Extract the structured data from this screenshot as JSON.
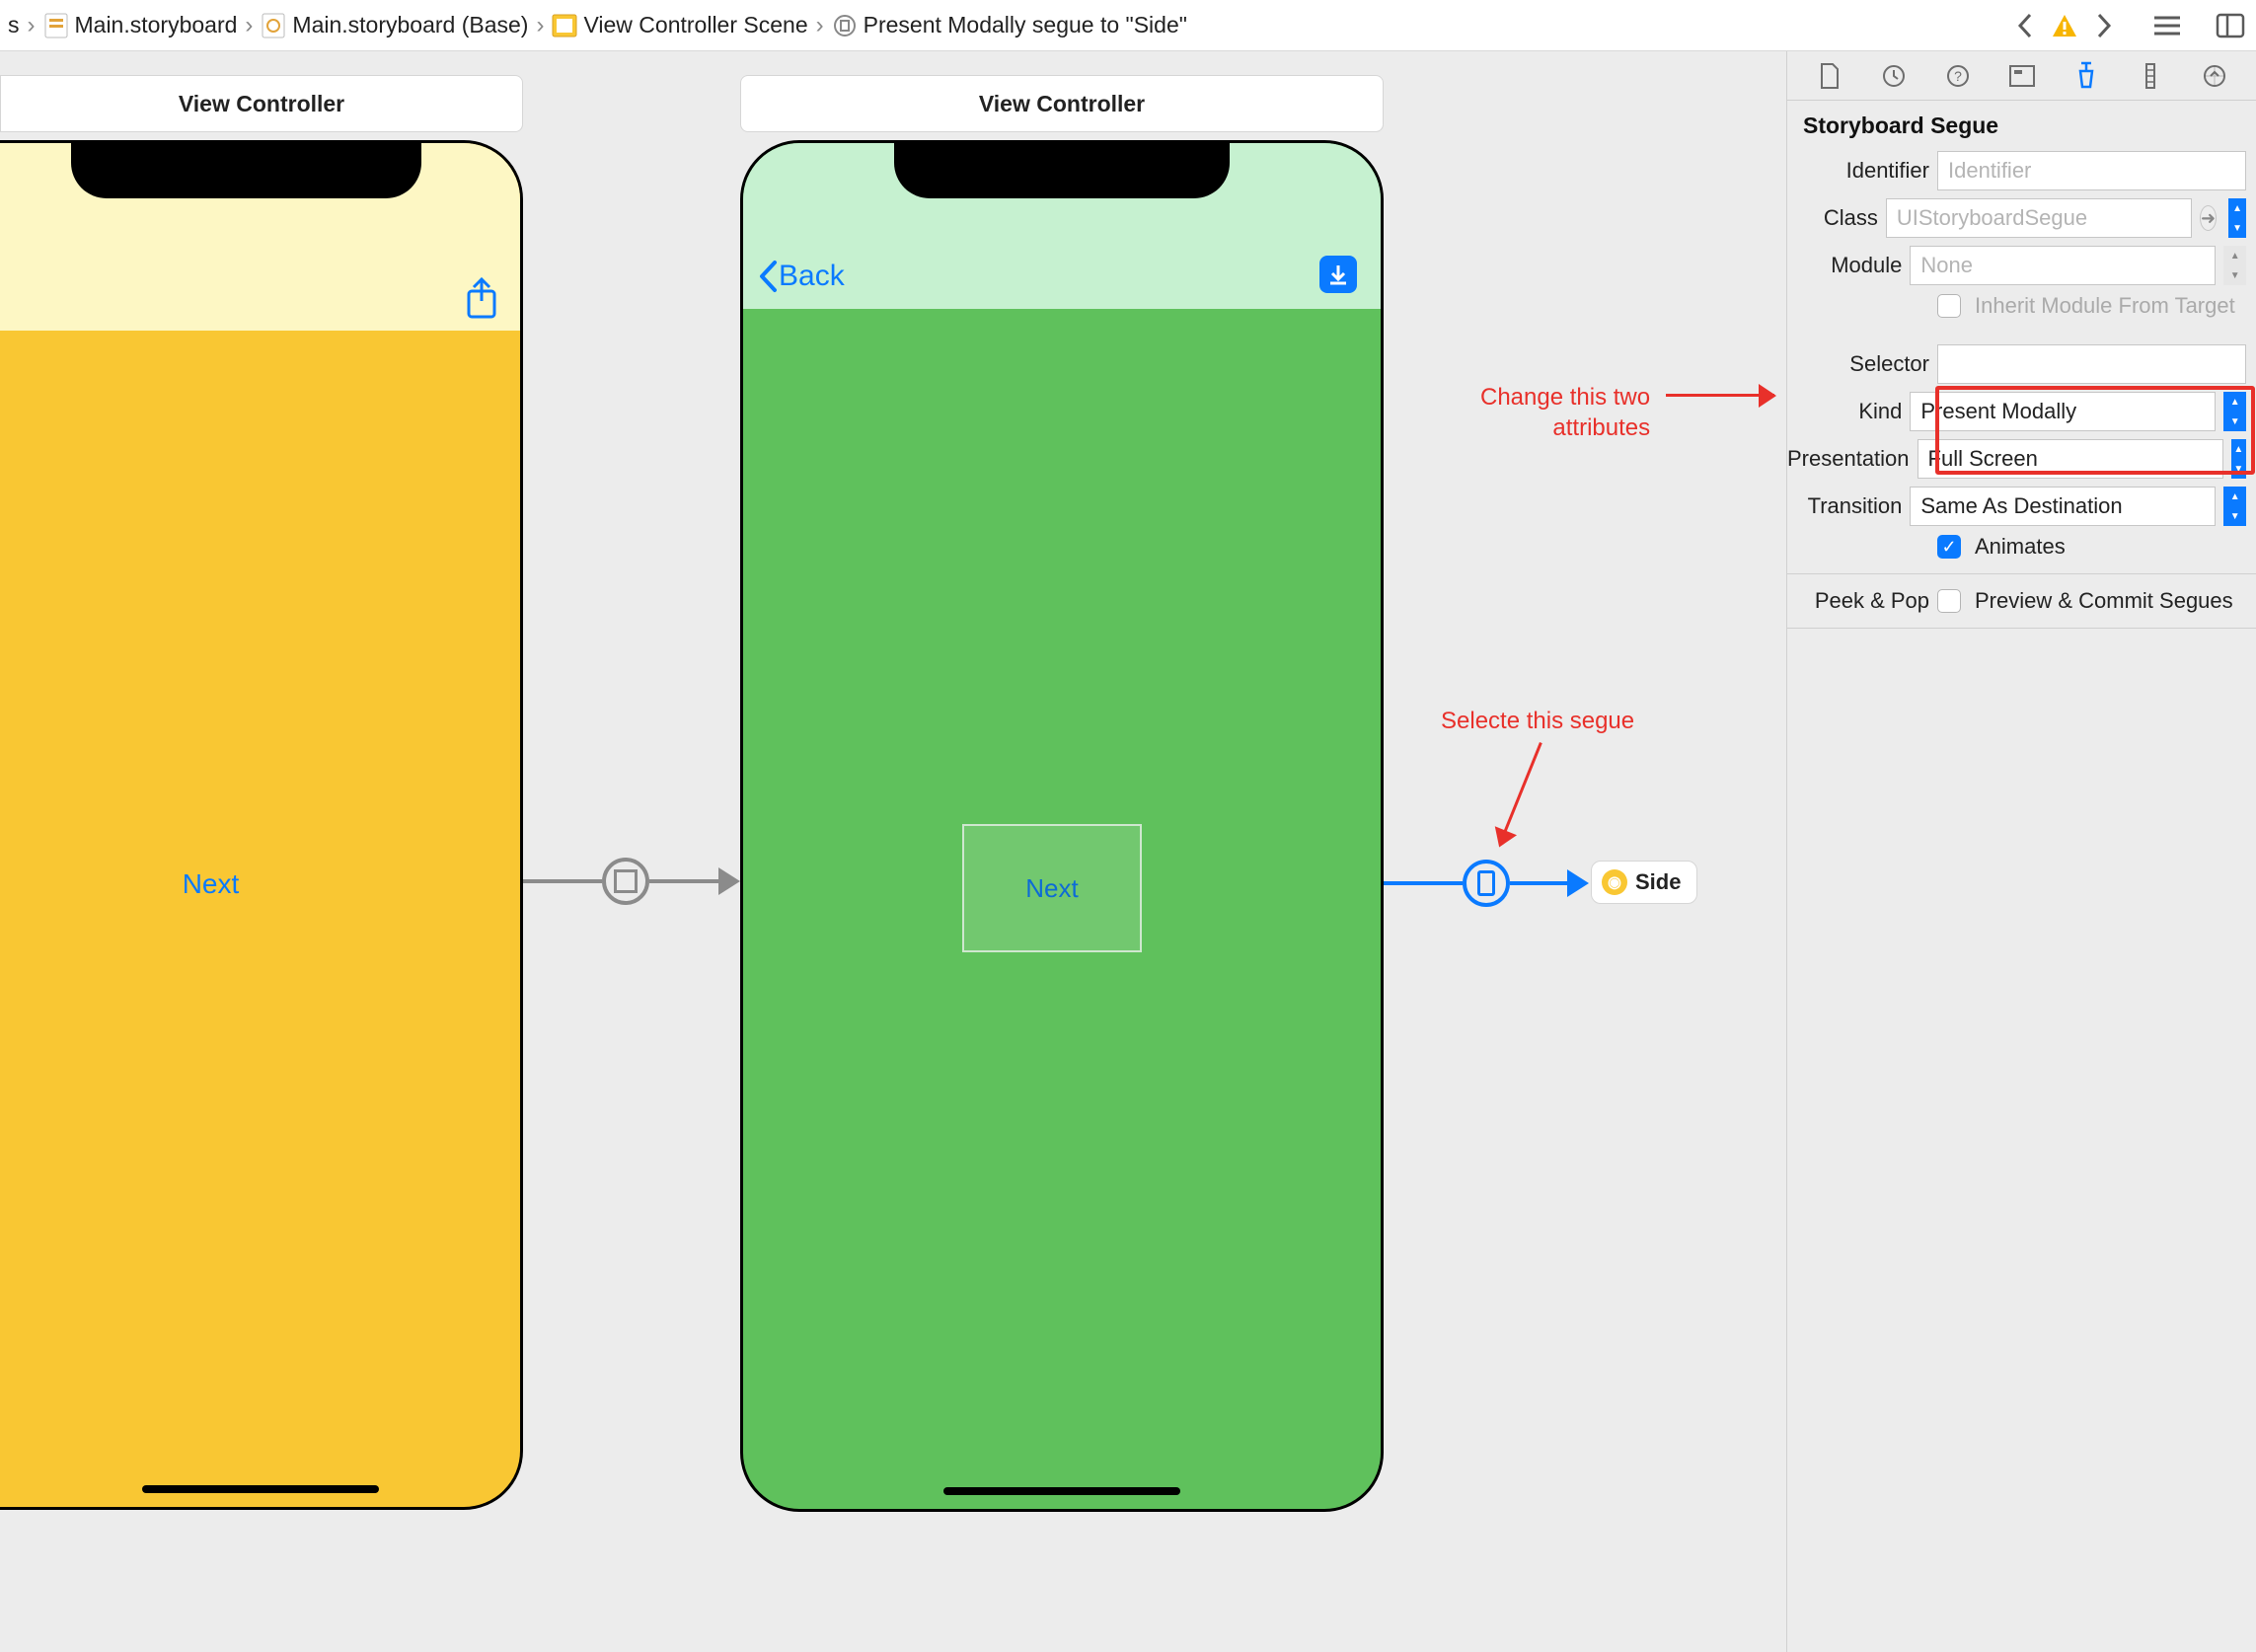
{
  "breadcrumbs": {
    "item0_suffix": "s",
    "item1": "Main.storyboard",
    "item2": "Main.storyboard (Base)",
    "item3": "View Controller Scene",
    "item4": "Present Modally segue to \"Side\""
  },
  "scenes": {
    "scene1": {
      "title": "View Controller",
      "button_label": "Next"
    },
    "scene2": {
      "title": "View Controller",
      "back_label": "Back",
      "container_label": "Next"
    },
    "side_badge": "Side"
  },
  "annotations": {
    "select_segue": "Selecte this segue",
    "change_attrs_line1": "Change this two",
    "change_attrs_line2": "attributes"
  },
  "inspector": {
    "section_title": "Storyboard Segue",
    "labels": {
      "identifier": "Identifier",
      "class": "Class",
      "module": "Module",
      "inherit": "Inherit Module From Target",
      "selector": "Selector",
      "kind": "Kind",
      "presentation": "Presentation",
      "transition": "Transition",
      "animates": "Animates",
      "peekpop": "Peek & Pop",
      "preview_commit": "Preview & Commit Segues"
    },
    "values": {
      "identifier_placeholder": "Identifier",
      "class_placeholder": "UIStoryboardSegue",
      "module_placeholder": "None",
      "kind": "Present Modally",
      "presentation": "Full Screen",
      "transition": "Same As Destination"
    }
  }
}
